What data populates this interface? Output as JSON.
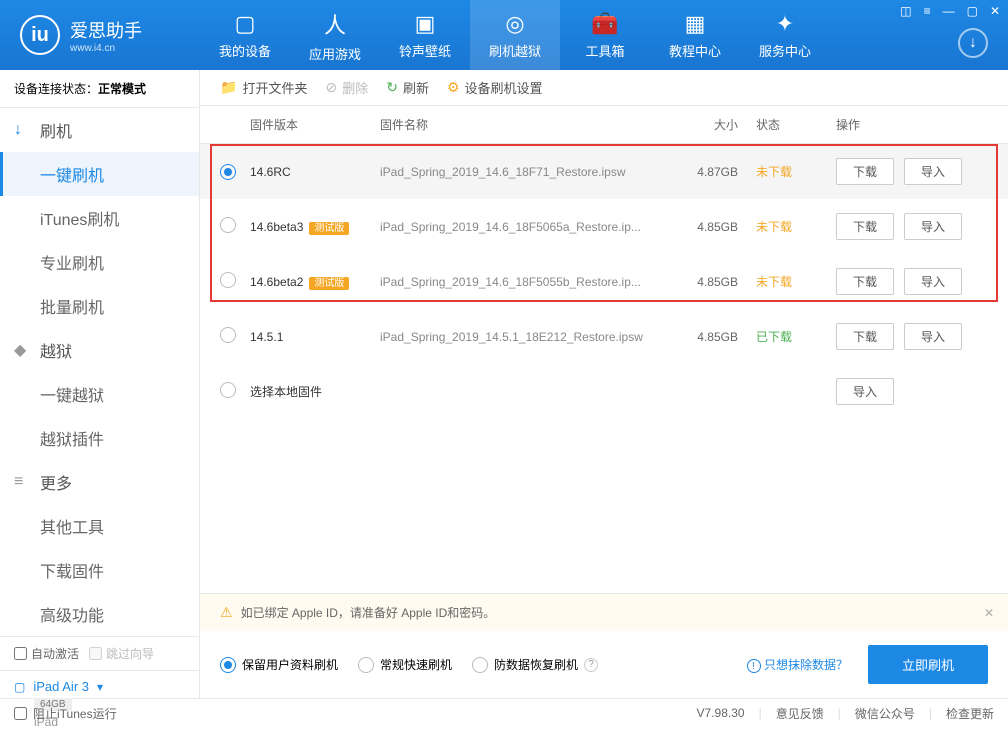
{
  "app": {
    "title": "爱思助手",
    "subtitle": "www.i4.cn"
  },
  "nav": [
    {
      "icon": "▢",
      "label": "我的设备"
    },
    {
      "icon": "人",
      "label": "应用游戏"
    },
    {
      "icon": "▣",
      "label": "铃声壁纸"
    },
    {
      "icon": "◎",
      "label": "刷机越狱"
    },
    {
      "icon": "🧰",
      "label": "工具箱"
    },
    {
      "icon": "▦",
      "label": "教程中心"
    },
    {
      "icon": "✦",
      "label": "服务中心"
    }
  ],
  "status": {
    "label": "设备连接状态：",
    "value": "正常模式"
  },
  "sidebar": {
    "groups": [
      {
        "icon": "↓",
        "title": "刷机",
        "items": [
          "一键刷机",
          "iTunes刷机",
          "专业刷机",
          "批量刷机"
        ]
      },
      {
        "icon": "◆",
        "title": "越狱",
        "items": [
          "一键越狱",
          "越狱插件"
        ]
      },
      {
        "icon": "≡",
        "title": "更多",
        "items": [
          "其他工具",
          "下载固件",
          "高级功能"
        ]
      }
    ],
    "footer": {
      "auto_activate": "自动激活",
      "skip_guide": "跳过向导",
      "device": "iPad Air 3",
      "storage": "64GB",
      "type": "iPad"
    }
  },
  "toolbar": {
    "open": "打开文件夹",
    "delete": "删除",
    "refresh": "刷新",
    "settings": "设备刷机设置"
  },
  "columns": {
    "version": "固件版本",
    "name": "固件名称",
    "size": "大小",
    "status": "状态",
    "ops": "操作"
  },
  "rows": [
    {
      "version": "14.6RC",
      "beta": false,
      "name": "iPad_Spring_2019_14.6_18F71_Restore.ipsw",
      "size": "4.87GB",
      "status": "未下载",
      "downloaded": false,
      "selected": true,
      "showDownload": true
    },
    {
      "version": "14.6beta3",
      "beta": true,
      "name": "iPad_Spring_2019_14.6_18F5065a_Restore.ip...",
      "size": "4.85GB",
      "status": "未下载",
      "downloaded": false,
      "selected": false,
      "showDownload": true
    },
    {
      "version": "14.6beta2",
      "beta": true,
      "name": "iPad_Spring_2019_14.6_18F5055b_Restore.ip...",
      "size": "4.85GB",
      "status": "未下载",
      "downloaded": false,
      "selected": false,
      "showDownload": true
    },
    {
      "version": "14.5.1",
      "beta": false,
      "name": "iPad_Spring_2019_14.5.1_18E212_Restore.ipsw",
      "size": "4.85GB",
      "status": "已下载",
      "downloaded": true,
      "selected": false,
      "showDownload": true
    },
    {
      "version": "选择本地固件",
      "beta": false,
      "name": "",
      "size": "",
      "status": "",
      "downloaded": false,
      "selected": false,
      "showDownload": false
    }
  ],
  "buttons": {
    "download": "下载",
    "import": "导入"
  },
  "beta_tag": "测试版",
  "notice": "如已绑定 Apple ID，请准备好 Apple ID和密码。",
  "modes": {
    "keep": "保留用户资料刷机",
    "normal": "常规快速刷机",
    "anti": "防数据恢复刷机",
    "erase": "只想抹除数据？",
    "flash": "立即刷机"
  },
  "footer": {
    "block_itunes": "阻止iTunes运行",
    "version": "V7.98.30",
    "feedback": "意见反馈",
    "wechat": "微信公众号",
    "update": "检查更新"
  }
}
